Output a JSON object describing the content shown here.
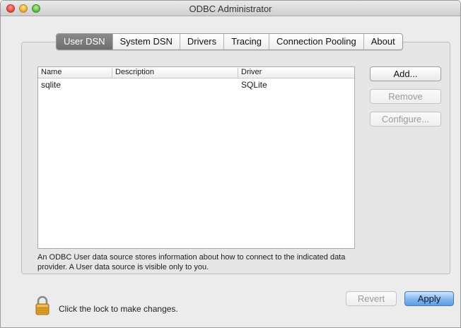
{
  "window": {
    "title": "ODBC Administrator"
  },
  "tabs": [
    {
      "label": "User DSN",
      "active": true
    },
    {
      "label": "System DSN",
      "active": false
    },
    {
      "label": "Drivers",
      "active": false
    },
    {
      "label": "Tracing",
      "active": false
    },
    {
      "label": "Connection Pooling",
      "active": false
    },
    {
      "label": "About",
      "active": false
    }
  ],
  "table": {
    "columns": [
      "Name",
      "Description",
      "Driver"
    ],
    "rows": [
      {
        "name": "sqlite",
        "description": "",
        "driver": "SQLite"
      }
    ]
  },
  "buttons": {
    "add": "Add...",
    "remove": "Remove",
    "configure": "Configure...",
    "revert": "Revert",
    "apply": "Apply"
  },
  "help_text": "An ODBC User data source stores information about how to connect to the indicated data provider. A User data source is visible only to you.",
  "lock": {
    "text": "Click the lock to make changes."
  },
  "colors": {
    "active_tab": "#7b7b7b",
    "default_button": "#6aa8ea"
  },
  "icons": {
    "lock": "padlock-icon"
  }
}
